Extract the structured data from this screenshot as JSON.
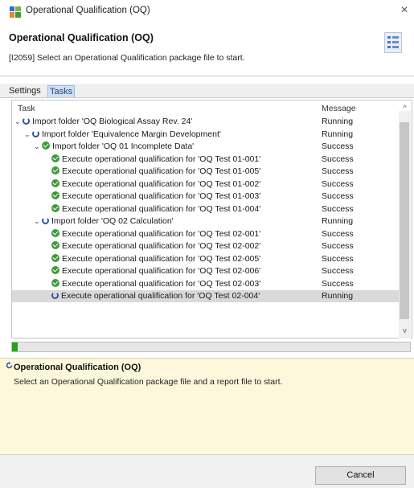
{
  "window": {
    "title": "Operational Qualification (OQ)",
    "close_glyph": "×",
    "app_icon": "qualification-app-icon"
  },
  "header": {
    "title": "Operational Qualification (OQ)",
    "message": "[I2059] Select an Operational Qualification package file to start.",
    "icon": "task-list-icon"
  },
  "tabs": [
    {
      "label": "Settings",
      "selected": false
    },
    {
      "label": "Tasks",
      "selected": true
    }
  ],
  "tree": {
    "columns": {
      "task": "Task",
      "message": "Message"
    },
    "rows": [
      {
        "depth": 0,
        "twisty": "expanded",
        "status": "running",
        "task": "Import folder 'OQ Biological Assay Rev. 24'",
        "message": "Running"
      },
      {
        "depth": 1,
        "twisty": "expanded",
        "status": "running",
        "task": "Import folder 'Equivalence Margin Development'",
        "message": "Running"
      },
      {
        "depth": 2,
        "twisty": "expanded",
        "status": "success",
        "task": "Import folder 'OQ 01 Incomplete Data'",
        "message": "Success"
      },
      {
        "depth": 3,
        "twisty": "none",
        "status": "success",
        "task": "Execute operational qualification for 'OQ Test 01-001'",
        "message": "Success"
      },
      {
        "depth": 3,
        "twisty": "none",
        "status": "success",
        "task": "Execute operational qualification for 'OQ Test 01-005'",
        "message": "Success"
      },
      {
        "depth": 3,
        "twisty": "none",
        "status": "success",
        "task": "Execute operational qualification for 'OQ Test 01-002'",
        "message": "Success"
      },
      {
        "depth": 3,
        "twisty": "none",
        "status": "success",
        "task": "Execute operational qualification for 'OQ Test 01-003'",
        "message": "Success"
      },
      {
        "depth": 3,
        "twisty": "none",
        "status": "success",
        "task": "Execute operational qualification for 'OQ Test 01-004'",
        "message": "Success"
      },
      {
        "depth": 2,
        "twisty": "expanded",
        "status": "running",
        "task": "Import folder 'OQ 02 Calculation'",
        "message": "Running"
      },
      {
        "depth": 3,
        "twisty": "none",
        "status": "success",
        "task": "Execute operational qualification for 'OQ Test 02-001'",
        "message": "Success"
      },
      {
        "depth": 3,
        "twisty": "none",
        "status": "success",
        "task": "Execute operational qualification for 'OQ Test 02-002'",
        "message": "Success"
      },
      {
        "depth": 3,
        "twisty": "none",
        "status": "success",
        "task": "Execute operational qualification for 'OQ Test 02-005'",
        "message": "Success"
      },
      {
        "depth": 3,
        "twisty": "none",
        "status": "success",
        "task": "Execute operational qualification for 'OQ Test 02-006'",
        "message": "Success"
      },
      {
        "depth": 3,
        "twisty": "none",
        "status": "success",
        "task": "Execute operational qualification for 'OQ Test 02-003'",
        "message": "Success"
      },
      {
        "depth": 3,
        "twisty": "none",
        "status": "running",
        "task": "Execute operational qualification for 'OQ Test 02-004'",
        "message": "Running",
        "selected": true
      }
    ]
  },
  "progress": {
    "fraction": 0.015,
    "color": "#1ea51e"
  },
  "info": {
    "title": "Operational Qualification (OQ)",
    "text": "Select an Operational Qualification package file and a report file to start.",
    "icon": "running-status-icon"
  },
  "footer": {
    "cancel_label": "Cancel"
  },
  "colors": {
    "success": "#3f9a3a",
    "running": "#2d5a9a",
    "info_bg": "#fdf8db",
    "selected_row": "#d9d9d9"
  }
}
